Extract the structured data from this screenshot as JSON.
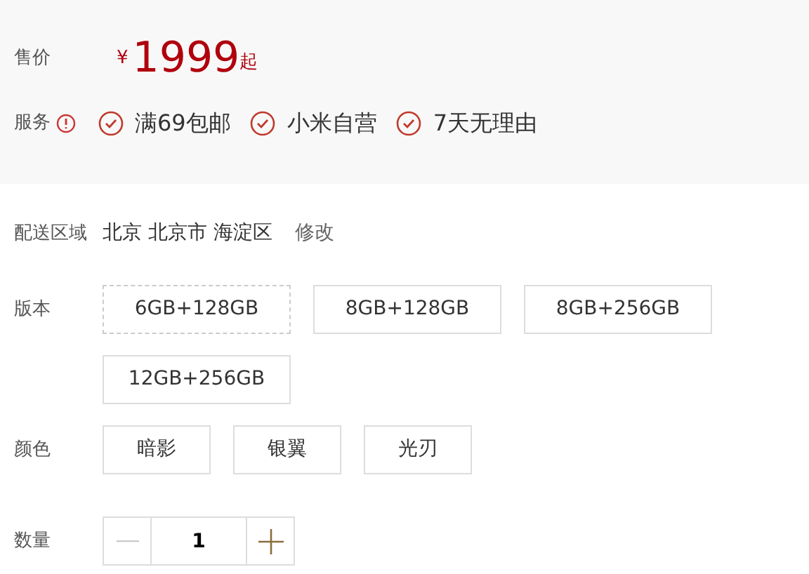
{
  "price": {
    "label": "售价",
    "currency": "¥",
    "amount": "1999",
    "suffix": "起"
  },
  "service": {
    "label": "服务",
    "items": [
      "满69包邮",
      "小米自营",
      "7天无理由"
    ]
  },
  "delivery": {
    "label": "配送区域",
    "region": "北京 北京市 海淀区",
    "change": "修改"
  },
  "version": {
    "label": "版本",
    "options": [
      {
        "text": "6GB+128GB",
        "selected": true
      },
      {
        "text": "8GB+128GB",
        "selected": false
      },
      {
        "text": "8GB+256GB",
        "selected": false
      },
      {
        "text": "12GB+256GB",
        "selected": false
      }
    ]
  },
  "color": {
    "label": "颜色",
    "options": [
      {
        "text": "暗影",
        "selected": false
      },
      {
        "text": "银翼",
        "selected": false
      },
      {
        "text": "光刃",
        "selected": false
      }
    ]
  },
  "quantity": {
    "label": "数量",
    "value": "1",
    "minus_disabled": true
  }
}
